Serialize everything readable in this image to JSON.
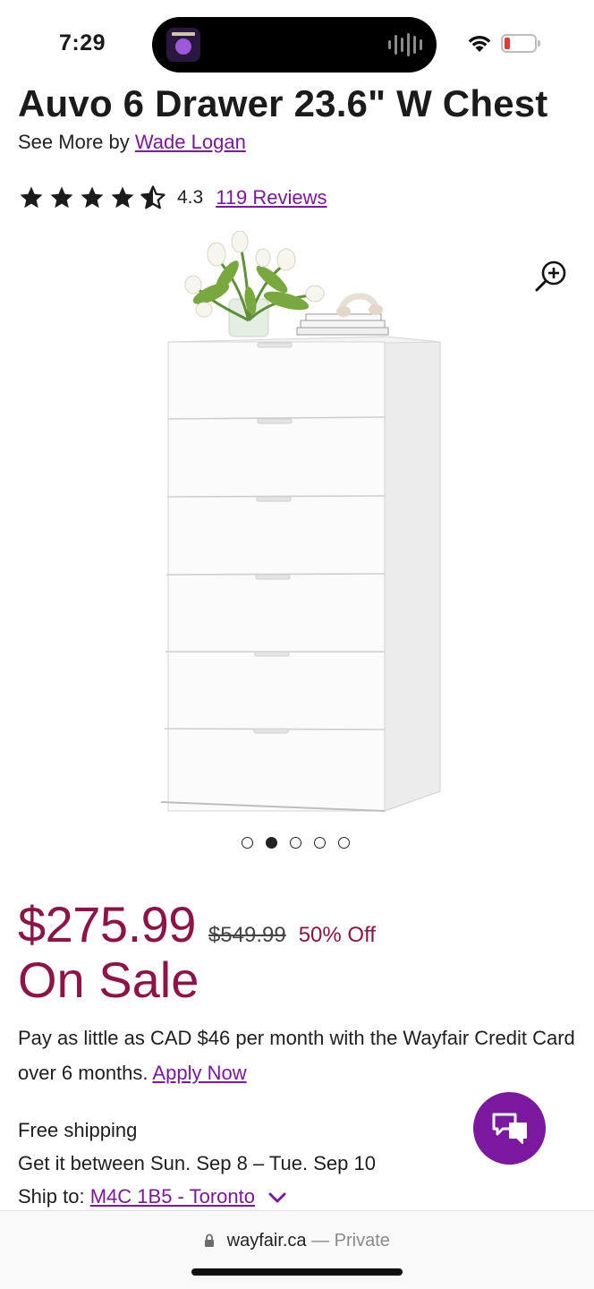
{
  "status_bar": {
    "time": "7:29"
  },
  "product": {
    "title": "Auvo 6 Drawer 23.6\" W Chest",
    "see_more_prefix": "See More by",
    "brand": "Wade Logan",
    "rating": "4.3",
    "rating_value": 4.3,
    "rating_max": 5,
    "reviews_link": "119 Reviews",
    "image_count": 5,
    "active_image_index": 1
  },
  "pricing": {
    "price": "$275.99",
    "original_price": "$549.99",
    "discount": "50% Off",
    "sale_label": "On Sale",
    "credit_text": "Pay as little as CAD $46 per month with the Wayfair Credit Card over 6 months.",
    "apply_link": "Apply Now"
  },
  "shipping": {
    "free_label": "Free shipping",
    "delivery": "Get it between Sun. Sep 8 – Tue. Sep 10",
    "ship_to_label": "Ship to:",
    "location": "M4C 1B5 - Toronto"
  },
  "browser": {
    "domain": "wayfair.ca",
    "mode": "— Private"
  },
  "colors": {
    "accent_purple": "#7b189f",
    "sale_red": "#8e1347"
  },
  "icons": {
    "zoom": "zoom-in-icon",
    "chat": "chat-icon",
    "lock": "lock-icon",
    "chevron": "chevron-down-icon"
  }
}
